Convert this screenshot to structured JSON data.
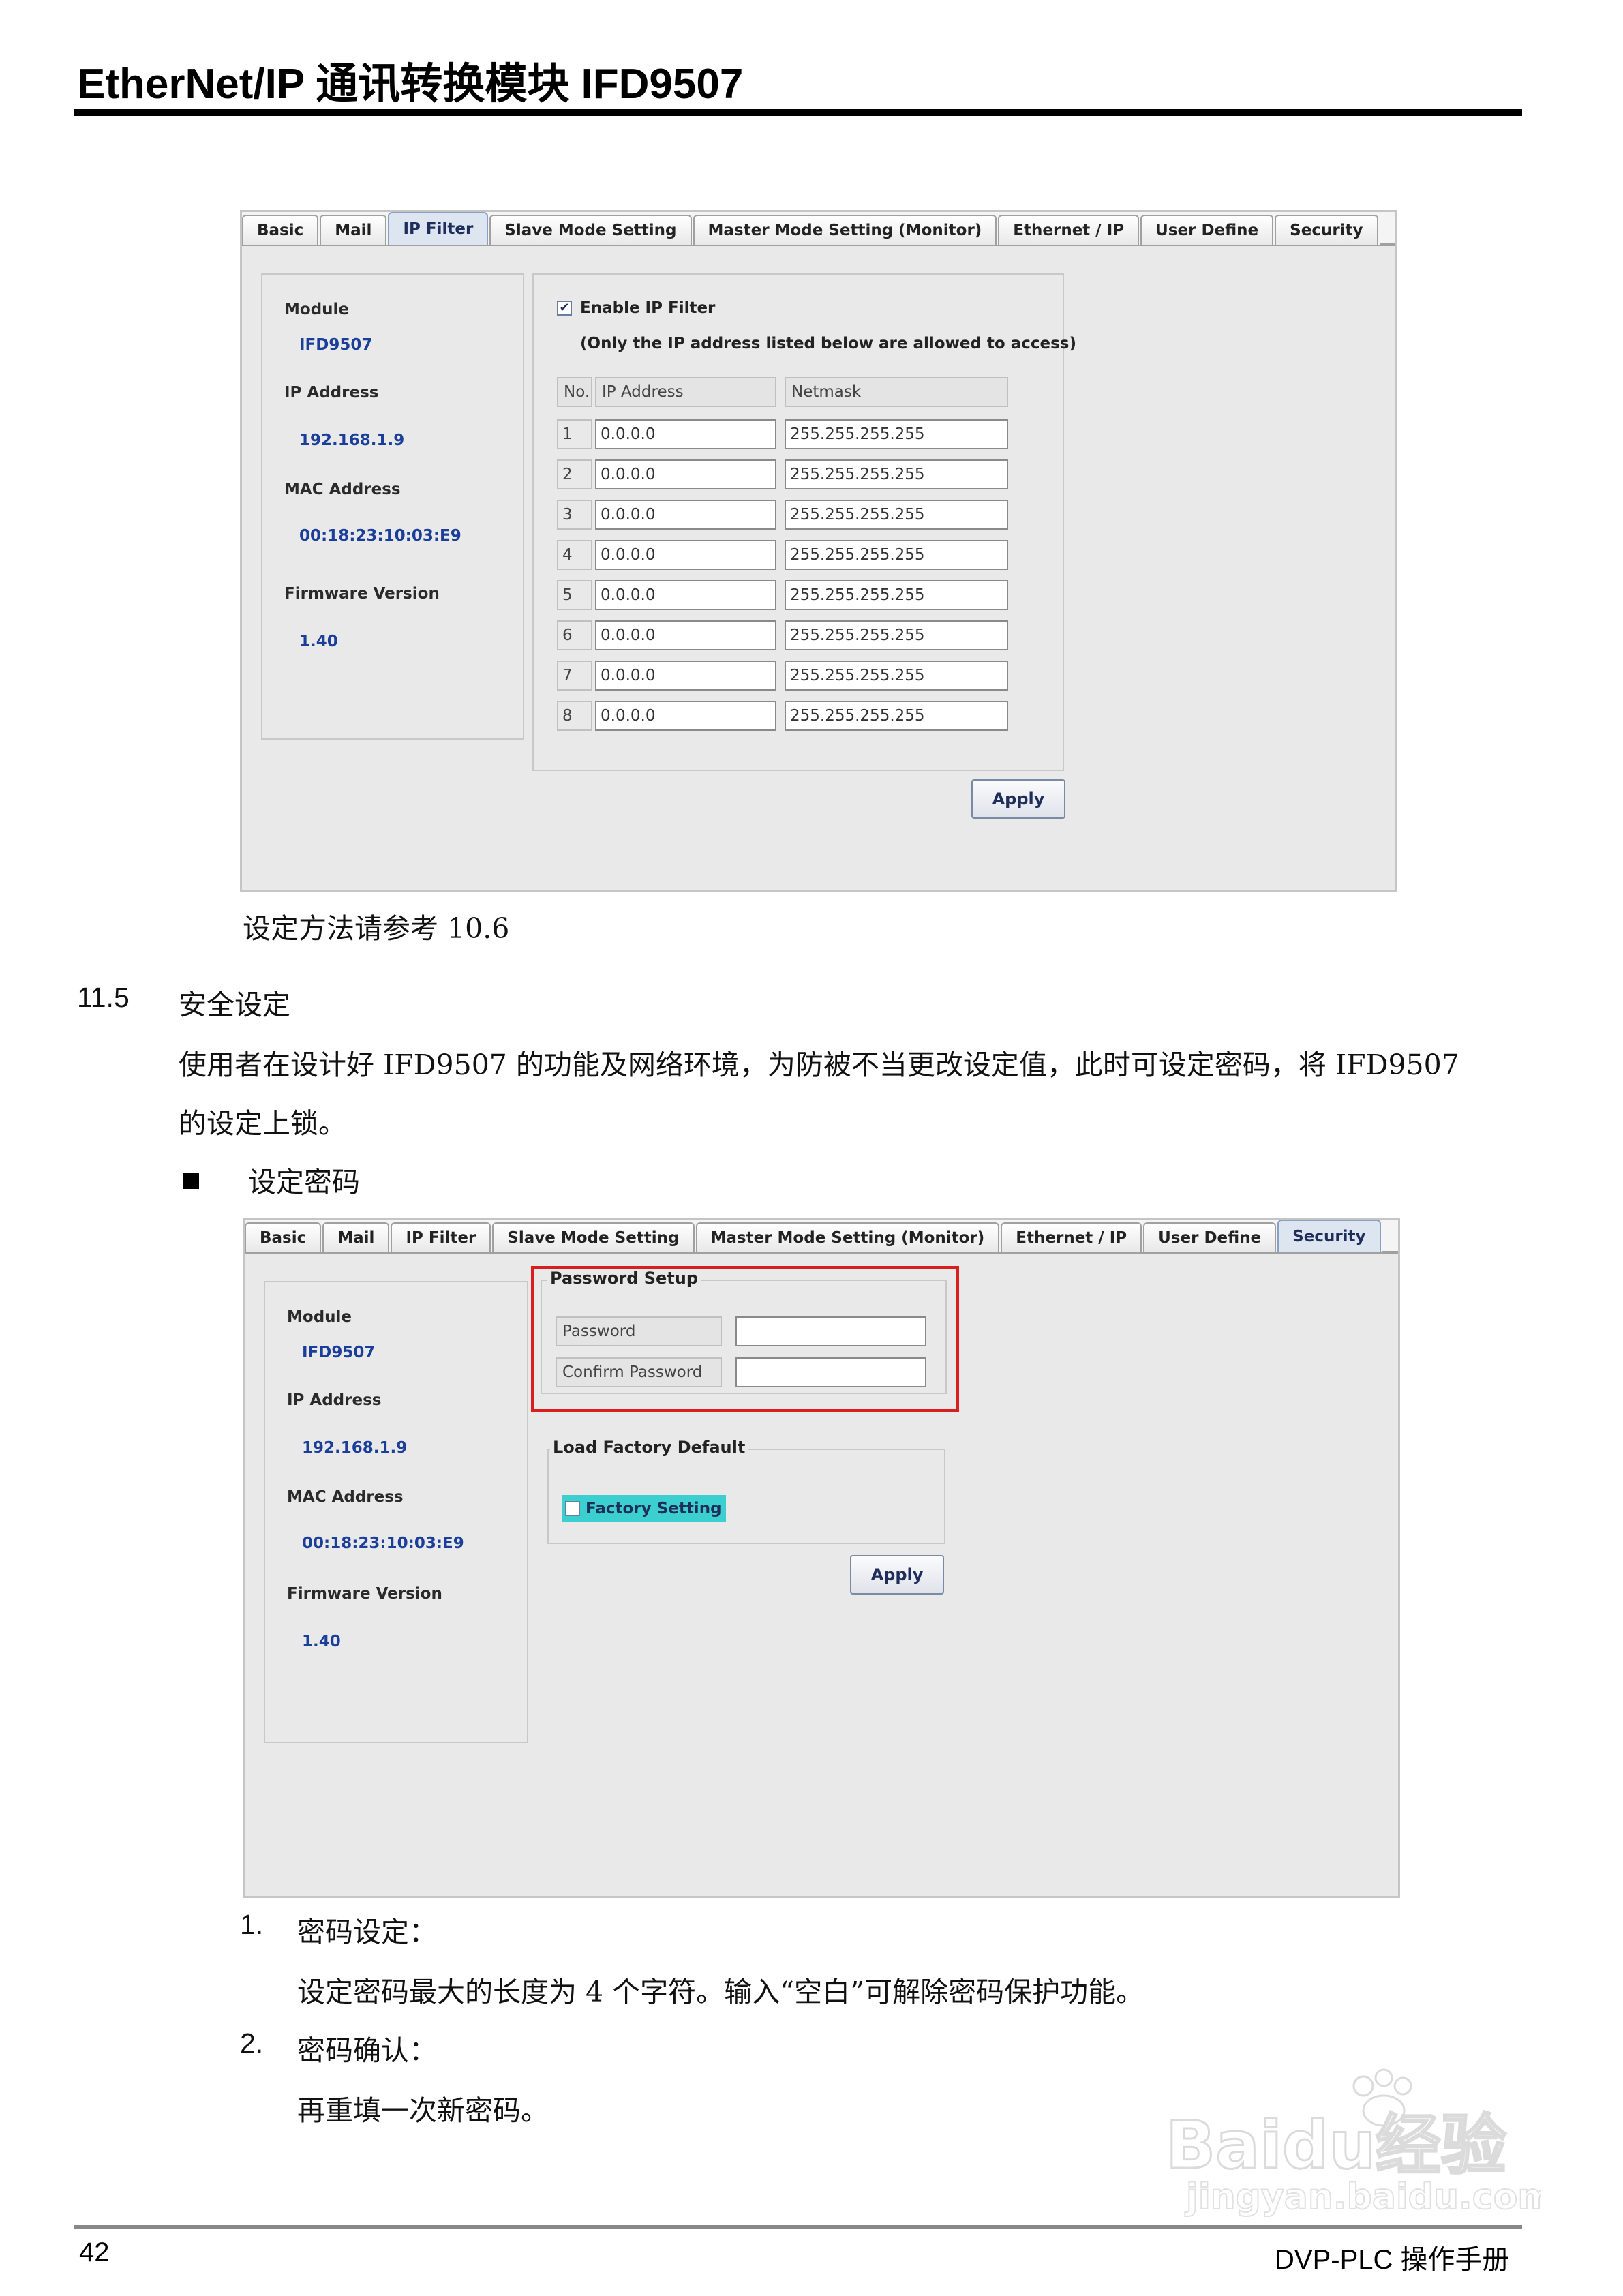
{
  "header": {
    "title": "EtherNet/IP 通讯转换模块  IFD9507"
  },
  "tabs": [
    "Basic",
    "Mail",
    "IP Filter",
    "Slave Mode Setting",
    "Master Mode Setting (Monitor)",
    "Ethernet / IP",
    "User Define",
    "Security"
  ],
  "info": {
    "module_label": "Module",
    "module_value": "IFD9507",
    "ip_label": "IP Address",
    "ip_value": "192.168.1.9",
    "mac_label": "MAC Address",
    "mac_value": "00:18:23:10:03:E9",
    "fw_label": "Firmware Version",
    "fw_value": "1.40"
  },
  "ip_filter": {
    "enable_label": "Enable IP Filter",
    "note": "(Only the IP address listed below are allowed to access)",
    "col_no": "No.",
    "col_ip": "IP Address",
    "col_mask": "Netmask",
    "rows": [
      {
        "no": "1",
        "ip": "0.0.0.0",
        "mask": "255.255.255.255"
      },
      {
        "no": "2",
        "ip": "0.0.0.0",
        "mask": "255.255.255.255"
      },
      {
        "no": "3",
        "ip": "0.0.0.0",
        "mask": "255.255.255.255"
      },
      {
        "no": "4",
        "ip": "0.0.0.0",
        "mask": "255.255.255.255"
      },
      {
        "no": "5",
        "ip": "0.0.0.0",
        "mask": "255.255.255.255"
      },
      {
        "no": "6",
        "ip": "0.0.0.0",
        "mask": "255.255.255.255"
      },
      {
        "no": "7",
        "ip": "0.0.0.0",
        "mask": "255.255.255.255"
      },
      {
        "no": "8",
        "ip": "0.0.0.0",
        "mask": "255.255.255.255"
      }
    ],
    "apply": "Apply"
  },
  "caption1": "设定方法请参考 10.6",
  "section": {
    "number": "11.5",
    "title": "安全设定"
  },
  "para_line1": "使用者在设计好 IFD9507 的功能及网络环境，为防被不当更改设定值，此时可设定密码，将 IFD9507",
  "para_line2": "的设定上锁。",
  "bullet": "设定密码",
  "security": {
    "password_group": "Password Setup",
    "password_label": "Password",
    "confirm_label": "Confirm Password",
    "factory_group": "Load Factory Default",
    "factory_label": "Factory Setting",
    "apply": "Apply"
  },
  "list": [
    {
      "num": "1.",
      "title": "密码设定：",
      "desc": "设定密码最大的长度为 4 个字符。输入“空白”可解除密码保护功能。"
    },
    {
      "num": "2.",
      "title": "密码确认：",
      "desc": "再重填一次新密码。"
    }
  ],
  "watermark": {
    "line1": "Baidu经验",
    "line2": "jingyan.baidu.com"
  },
  "footer": {
    "page": "42",
    "manual": "DVP-PLC 操作手册"
  },
  "colors": {
    "red_highlight": "#d81e1e",
    "value_blue": "#1a3e9a",
    "factory_highlight": "#3ccfd0"
  }
}
